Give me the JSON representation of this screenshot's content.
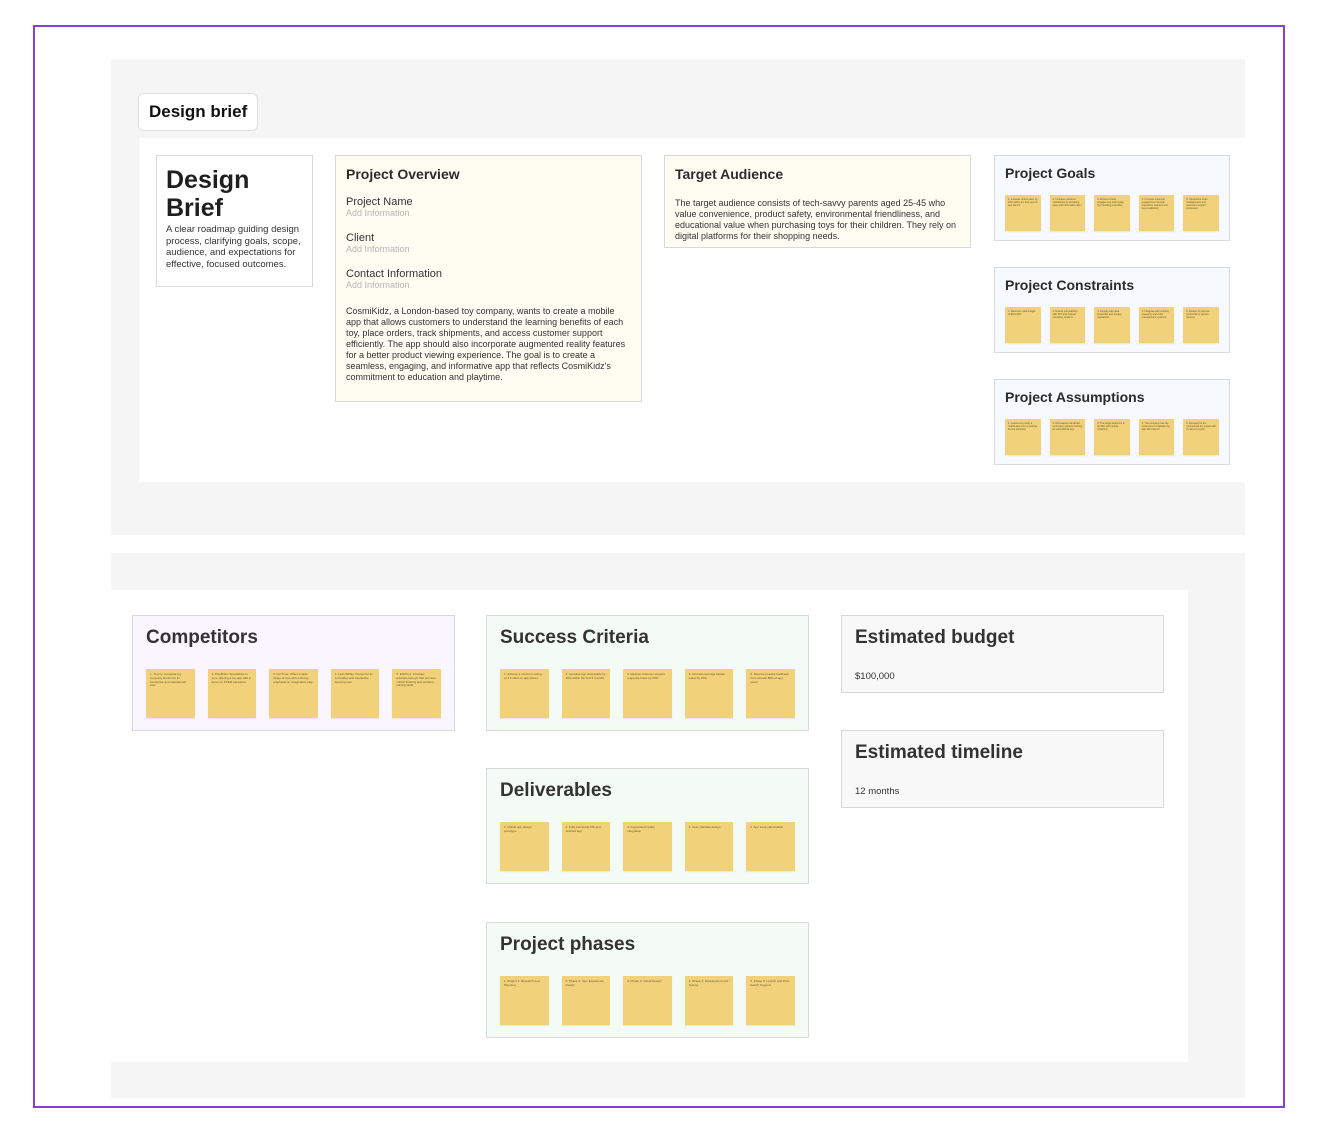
{
  "tab": {
    "label": "Design brief"
  },
  "brief": {
    "title": "Design Brief",
    "description": "A clear roadmap guiding design process, clarifying goals, scope, audience, and expectations for effective, focused outcomes."
  },
  "overview": {
    "title": "Project Overview",
    "fields": [
      {
        "label": "Project Name",
        "placeholder": "Add Information"
      },
      {
        "label": "Client",
        "placeholder": "Add Information"
      },
      {
        "label": "Contact Information",
        "placeholder": "Add Information"
      }
    ],
    "body": "CosmiKidz, a London-based toy company, wants to create a mobile app that allows customers to understand the learning benefits of each toy, place orders, track shipments, and access customer support efficiently. The app should also incorporate augmented reality features for a better product viewing experience. The goal is to create a seamless, engaging, and informative app that reflects CosmiKidz's commitment to education and playtime."
  },
  "audience": {
    "title": "Target Audience",
    "body": "The target audience consists of tech-savvy parents aged 25-45 who value convenience, product safety, environmental friendliness, and educational value when purchasing toys for their children. They rely on digital platforms for their shopping needs."
  },
  "goals": {
    "title": "Project Goals",
    "notes": [
      "1. Increase online sales by 20% within the first year of app launch",
      "2. Increase customer satisfaction by providing easy and informative app",
      "3. Achieve brand engagement and loyalty by providing innovative",
      "4. Increase customer engagement through interactive features and personalization",
      "5. Streamline order management and customer support processes"
    ]
  },
  "constraints": {
    "title": "Project Constraints",
    "notes": [
      "1. Maximum total budget of $100,000",
      "2. Ensure compatibility with iOS and Android operating systems",
      "3. Comply with data protection and privacy regulations",
      "4. Integrate with existing inventory and order management systems",
      "5. Design for optimal performance across devices"
    ]
  },
  "assumptions": {
    "title": "Project Assumptions",
    "notes": [
      "1. Customers prefer a mobile app over a website for the purchase",
      "2. AR features will attract tech-savvy parents looking for educational toys",
      "3. The target audience is familiar with mobile shopping",
      "4. The company has the resources to maintain the app after launch",
      "5. Demand for the educational toy market will continue to grow"
    ]
  },
  "competitors": {
    "title": "Competitors",
    "notes": [
      "1. Toyzzy: A popular toy company known for its interactive and educational toys.",
      "2. PlayBrain: Specializes in toys, offering a toy app with a focus on STEM education.",
      "3. FunTime: Offers a wide range of toys with a strong emphasis on imaginative play.",
      "4. LearnNPlay: Known for its innovative and interactive learning toys.",
      "5. EduToys: Provides educational toys that promote critical thinking and problem-solving skills."
    ]
  },
  "success": {
    "title": "Success Criteria",
    "notes": [
      "1. Achieve a minimum rating of 4.5 stars on app stores",
      "2. Increase app downloads by 30% within the first 6 months",
      "3. Reduce customer support response times by 25%",
      "4. Increase average basket value by 15%",
      "5. Receive positive feedback from at least 80% of app users"
    ]
  },
  "deliverables": {
    "title": "Deliverables",
    "notes": [
      "1. Mobile app design prototype",
      "2. Fully functional iOS and Android app",
      "3. Augmented reality integration",
      "4. User interface design",
      "5. App store optimization"
    ]
  },
  "phases": {
    "title": "Project phases",
    "notes": [
      "1. Project 1: Research and Planning",
      "2. Phase 2: User Experience Design",
      "3. Phase 3: Visual Design",
      "4. Phase 4: Development and Testing",
      "5. Phase 5: Launch and Post-launch Support"
    ]
  },
  "budget": {
    "title": "Estimated budget",
    "value": "$100,000"
  },
  "timeline": {
    "title": "Estimated timeline",
    "value": "12 months"
  }
}
